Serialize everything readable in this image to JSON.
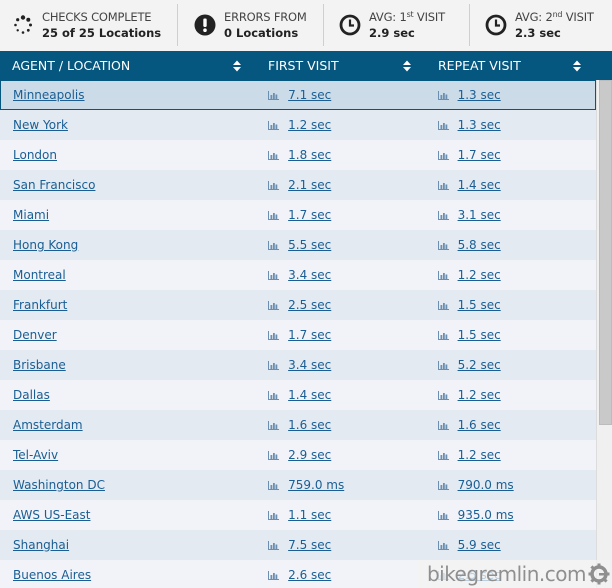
{
  "summary": {
    "checks": {
      "label": "CHECKS COMPLETE",
      "value": "25 of 25 Locations",
      "icon": "spinner-icon"
    },
    "errors": {
      "label": "ERRORS FROM",
      "value": "0 Locations",
      "icon": "exclamation-circle-icon"
    },
    "avg_first": {
      "label_prefix": "AVG: 1",
      "label_sup": "st",
      "label_suffix": " VISIT",
      "value": "2.9 sec",
      "icon": "clock-icon"
    },
    "avg_second": {
      "label_prefix": "AVG: 2",
      "label_sup": "nd",
      "label_suffix": " VISIT",
      "value": "2.3 sec",
      "icon": "clock-icon"
    }
  },
  "table": {
    "columns": [
      {
        "label": "AGENT / LOCATION",
        "icon": "sort-icon"
      },
      {
        "label": "FIRST VISIT",
        "icon": "sort-icon"
      },
      {
        "label": "REPEAT VISIT",
        "icon": "sort-icon"
      }
    ],
    "rows": [
      {
        "location": "Minneapolis",
        "first": "7.1 sec",
        "repeat": "1.3 sec",
        "selected": true
      },
      {
        "location": "New York",
        "first": "1.2 sec",
        "repeat": "1.3 sec"
      },
      {
        "location": "London",
        "first": "1.8 sec",
        "repeat": "1.7 sec"
      },
      {
        "location": "San Francisco",
        "first": "2.1 sec",
        "repeat": "1.4 sec"
      },
      {
        "location": "Miami",
        "first": "1.7 sec",
        "repeat": "3.1 sec"
      },
      {
        "location": "Hong Kong",
        "first": "5.5 sec",
        "repeat": "5.8 sec"
      },
      {
        "location": "Montreal",
        "first": "3.4 sec",
        "repeat": "1.2 sec"
      },
      {
        "location": "Frankfurt",
        "first": "2.5 sec",
        "repeat": "1.5 sec"
      },
      {
        "location": "Denver",
        "first": "1.7 sec",
        "repeat": "1.5 sec"
      },
      {
        "location": "Brisbane",
        "first": "3.4 sec",
        "repeat": "5.2 sec"
      },
      {
        "location": "Dallas",
        "first": "1.4 sec",
        "repeat": "1.2 sec"
      },
      {
        "location": "Amsterdam",
        "first": "1.6 sec",
        "repeat": "1.6 sec"
      },
      {
        "location": "Tel-Aviv",
        "first": "2.9 sec",
        "repeat": "1.2 sec"
      },
      {
        "location": "Washington DC",
        "first": "759.0 ms",
        "repeat": "790.0 ms"
      },
      {
        "location": "AWS US-East",
        "first": "1.1 sec",
        "repeat": "935.0 ms"
      },
      {
        "location": "Shanghai",
        "first": "7.5 sec",
        "repeat": "5.9 sec"
      },
      {
        "location": "Buenos Aires",
        "first": "2.6 sec",
        "repeat": "2.5 sec"
      }
    ]
  },
  "watermark": {
    "text": "bikegremlin.com",
    "icon": "gear-g-logo-icon"
  },
  "colors": {
    "header_bg": "#05577f",
    "link": "#1b5e93",
    "row_even": "#e3eaf2",
    "row_odd": "#f1f3f8",
    "row_selected": "#ccdbe8"
  }
}
